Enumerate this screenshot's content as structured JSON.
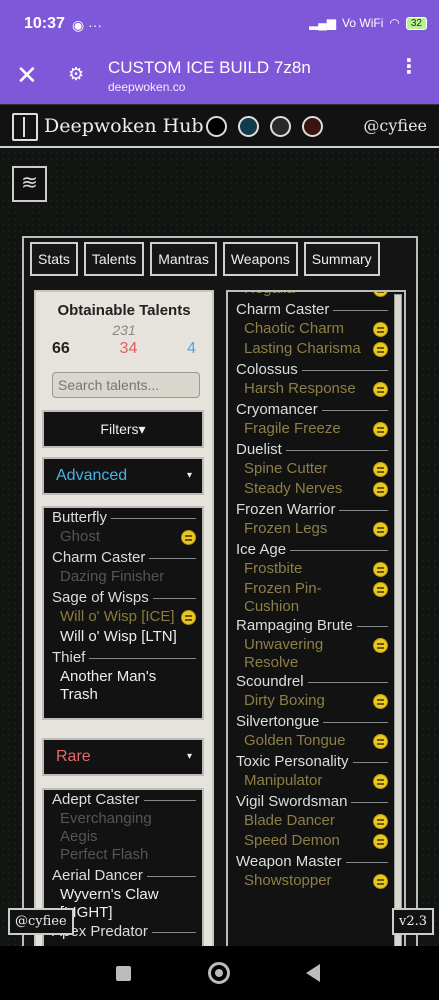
{
  "status_bar": {
    "time": "10:37",
    "icons_left": "◉ ···",
    "network": "Vo WiFi",
    "battery": "32"
  },
  "browser": {
    "title": "CUSTOM ICE BUILD 7z8n",
    "url": "deepwoken.co",
    "close": "✕",
    "settings": "⚙",
    "menu": "⋮"
  },
  "site": {
    "title": "Deepwoken Hub",
    "handle": "@cyfiee",
    "swatches": [
      "#000000",
      "#123c4b",
      "#2a2a2a",
      "#3a1410"
    ]
  },
  "nav": {
    "hamburger": "≋"
  },
  "tabs": [
    "Stats",
    "Talents",
    "Mantras",
    "Weapons",
    "Summary"
  ],
  "left_panel": {
    "title": "Obtainable Talents",
    "total": "231",
    "counts": [
      "66",
      "34",
      "4"
    ],
    "search_placeholder": "Search talents...",
    "filters_label": "Filters▾",
    "advanced_label": "Advanced",
    "advanced_arrow": "▾",
    "rare_label": "Rare",
    "rare_arrow": "▾",
    "advanced_list": [
      {
        "type": "cat",
        "text": "Butterfly"
      },
      {
        "type": "talent",
        "text": "Ghost",
        "style": "dim",
        "coin": true
      },
      {
        "type": "cat",
        "text": "Charm Caster"
      },
      {
        "type": "talent",
        "text": "Dazing Finisher",
        "style": "dim",
        "coin": false
      },
      {
        "type": "cat",
        "text": "Sage of Wisps"
      },
      {
        "type": "talent",
        "text": "Will o' Wisp [ICE]",
        "style": "gold",
        "coin": true
      },
      {
        "type": "talent",
        "text": "Will o' Wisp [LTN]",
        "style": "avail",
        "coin": false
      },
      {
        "type": "cat",
        "text": "Thief"
      },
      {
        "type": "talent",
        "text": "Another Man's Trash",
        "style": "avail",
        "coin": false
      }
    ],
    "rare_list": [
      {
        "type": "cat",
        "text": "Adept Caster"
      },
      {
        "type": "talent",
        "text": "Everchanging Aegis",
        "style": "dim",
        "coin": false
      },
      {
        "type": "talent",
        "text": "Perfect Flash",
        "style": "dim",
        "coin": false
      },
      {
        "type": "cat",
        "text": "Aerial Dancer"
      },
      {
        "type": "talent",
        "text": "Wyvern's Claw [LIGHT]",
        "style": "avail",
        "coin": false
      },
      {
        "type": "cat",
        "text": "Apex Predator"
      }
    ]
  },
  "right_panel": {
    "list": [
      {
        "type": "talent",
        "text": "Regalia",
        "coin": true
      },
      {
        "type": "cat",
        "text": "Charm Caster"
      },
      {
        "type": "talent",
        "text": "Chaotic Charm",
        "coin": true
      },
      {
        "type": "talent",
        "text": "Lasting Charisma",
        "coin": true
      },
      {
        "type": "cat",
        "text": "Colossus"
      },
      {
        "type": "talent",
        "text": "Harsh Response",
        "coin": true
      },
      {
        "type": "cat",
        "text": "Cryomancer"
      },
      {
        "type": "talent",
        "text": "Fragile Freeze",
        "coin": true
      },
      {
        "type": "cat",
        "text": "Duelist"
      },
      {
        "type": "talent",
        "text": "Spine Cutter",
        "coin": true
      },
      {
        "type": "talent",
        "text": "Steady Nerves",
        "coin": true
      },
      {
        "type": "cat",
        "text": "Frozen Warrior"
      },
      {
        "type": "talent",
        "text": "Frozen Legs",
        "coin": true
      },
      {
        "type": "cat",
        "text": "Ice Age"
      },
      {
        "type": "talent",
        "text": "Frostbite",
        "coin": true
      },
      {
        "type": "talent",
        "text": "Frozen Pin-Cushion",
        "coin": true
      },
      {
        "type": "cat",
        "text": "Rampaging Brute"
      },
      {
        "type": "talent",
        "text": "Unwavering Resolve",
        "coin": true
      },
      {
        "type": "cat",
        "text": "Scoundrel"
      },
      {
        "type": "talent",
        "text": "Dirty Boxing",
        "coin": true
      },
      {
        "type": "cat",
        "text": "Silvertongue"
      },
      {
        "type": "talent",
        "text": "Golden Tongue",
        "coin": true
      },
      {
        "type": "cat",
        "text": "Toxic Personality"
      },
      {
        "type": "talent",
        "text": "Manipulator",
        "coin": true
      },
      {
        "type": "cat",
        "text": "Vigil Swordsman"
      },
      {
        "type": "talent",
        "text": "Blade Dancer",
        "coin": true
      },
      {
        "type": "talent",
        "text": "Speed Demon",
        "coin": true
      },
      {
        "type": "cat",
        "text": "Weapon Master"
      },
      {
        "type": "talent",
        "text": "Showstopper",
        "coin": true
      }
    ]
  },
  "badges": {
    "handle": "@cyfiee",
    "version": "v2.3"
  }
}
